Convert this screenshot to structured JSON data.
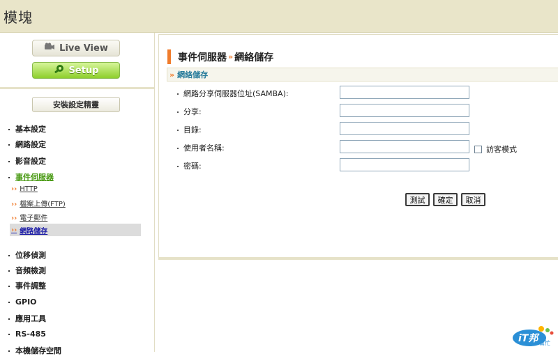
{
  "header": {
    "title": "模塊"
  },
  "sidebar": {
    "live_view_label": "Live View",
    "setup_label": "Setup",
    "wizard_label": "安裝設定精靈",
    "menu": [
      {
        "label": "基本設定"
      },
      {
        "label": "網路設定"
      },
      {
        "label": "影音設定"
      },
      {
        "label": "事件伺服器"
      },
      {
        "label": "位移偵測"
      },
      {
        "label": "音頻檢測"
      },
      {
        "label": "事件調整"
      },
      {
        "label": "GPIO"
      },
      {
        "label": "應用工具"
      },
      {
        "label": "RS-485"
      },
      {
        "label": "本機儲存空間"
      }
    ],
    "submenu": [
      {
        "label": "HTTP"
      },
      {
        "label": "檔案上傳(FTP)"
      },
      {
        "label": "電子郵件"
      },
      {
        "label": "網路儲存"
      }
    ]
  },
  "main": {
    "heading_part1": "事件伺服器",
    "heading_sep": "»",
    "heading_part2": "網絡儲存",
    "section_arrow": "»",
    "section_title": "網絡儲存",
    "fields": [
      {
        "label": "網路分享伺服器位址(SAMBA):",
        "value": ""
      },
      {
        "label": "分享:",
        "value": ""
      },
      {
        "label": "目錄:",
        "value": ""
      },
      {
        "label": "使用者名稱:",
        "value": ""
      },
      {
        "label": "密碼:",
        "value": ""
      }
    ],
    "guest_mode_label": "訪客模式",
    "buttons": {
      "test": "測試",
      "ok": "確定",
      "cancel": "取消"
    }
  },
  "logo": {
    "text": "iT邦",
    "sub": "幫忙"
  },
  "colors": {
    "accent_orange": "#f07c2c",
    "active_green": "#4a9a14",
    "setup_green": "#8ecf2d"
  }
}
